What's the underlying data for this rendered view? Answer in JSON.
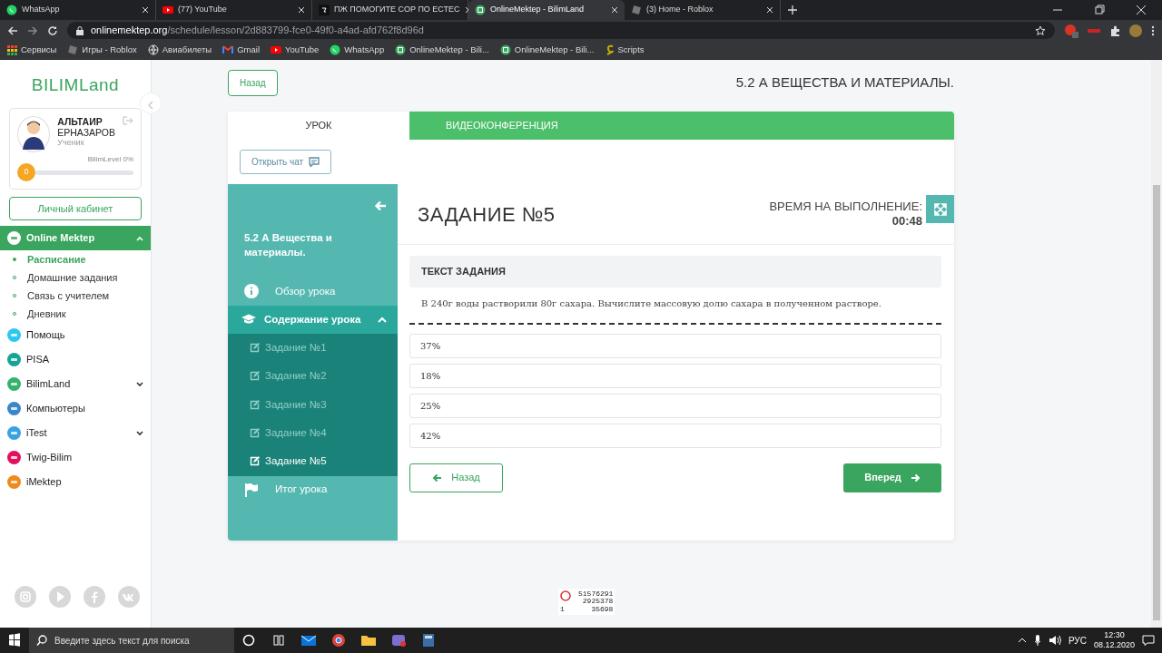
{
  "browser": {
    "tabs": [
      {
        "title": "WhatsApp",
        "kind": "whatsapp",
        "selected": false
      },
      {
        "title": "(77) YouTube",
        "kind": "youtube",
        "selected": false
      },
      {
        "title": "ПЖ ПОМОГИТЕ СОР ПО ЕСТЕС",
        "kind": "znanija",
        "selected": false
      },
      {
        "title": "OnlineMektep - BilimLand",
        "kind": "bilim",
        "selected": true
      },
      {
        "title": "(3) Home - Roblox",
        "kind": "roblox",
        "selected": false
      }
    ],
    "url_host": "onlinemektep.org",
    "url_path": "/schedule/lesson/2d883799-fce0-49f0-a4ad-afd762f8d96d",
    "bookmarks": [
      {
        "label": "Сервисы",
        "kind": "apps"
      },
      {
        "label": "Игры - Roblox",
        "kind": "roblox"
      },
      {
        "label": "Авиабилеты",
        "kind": "globe"
      },
      {
        "label": "Gmail",
        "kind": "gmail"
      },
      {
        "label": "YouTube",
        "kind": "youtube"
      },
      {
        "label": "WhatsApp",
        "kind": "whatsapp"
      },
      {
        "label": "OnlineMektep - Bili...",
        "kind": "bilim"
      },
      {
        "label": "OnlineMektep - Bili...",
        "kind": "bilim"
      },
      {
        "label": "Scripts",
        "kind": "script"
      }
    ]
  },
  "sidebar": {
    "logo": "BILIMLand",
    "user": {
      "first_name": "АЛЬТАИР",
      "last_name": "ЕРНАЗАРОВ",
      "role": "Ученик",
      "level_label": "BilimLevel 0%",
      "level_badge": "0",
      "level": 0
    },
    "cabinet_button": "Личный кабинет",
    "nav": [
      {
        "label": "Online Mektep",
        "color": "#ffffff",
        "expandable": true,
        "expanded": true,
        "children": [
          {
            "label": "Расписание",
            "selected": true
          },
          {
            "label": "Домашние задания",
            "selected": false
          },
          {
            "label": "Связь с учителем",
            "selected": false
          },
          {
            "label": "Дневник",
            "selected": false
          }
        ]
      },
      {
        "label": "Помощь",
        "color": "#2ec7f2",
        "expandable": false,
        "expanded": false
      },
      {
        "label": "PISA",
        "color": "#17a398",
        "expandable": false,
        "expanded": false
      },
      {
        "label": "BilimLand",
        "color": "#35b36a",
        "expandable": true,
        "expanded": false
      },
      {
        "label": "Компьютеры",
        "color": "#3a86c8",
        "expandable": false,
        "expanded": false
      },
      {
        "label": "iTest",
        "color": "#39a2e2",
        "expandable": true,
        "expanded": false
      },
      {
        "label": "Twig-Bilim",
        "color": "#e0125e",
        "expandable": false,
        "expanded": false
      },
      {
        "label": "iMektep",
        "color": "#ef8a1c",
        "expandable": false,
        "expanded": false
      }
    ],
    "socials": [
      {
        "kind": "instagram"
      },
      {
        "kind": "play"
      },
      {
        "kind": "facebook"
      },
      {
        "kind": "vk"
      }
    ]
  },
  "main": {
    "back_button": "Назад",
    "lesson_title": "5.2 А ВЕЩЕСТВА И МАТЕРИАЛЫ.",
    "tabs": [
      {
        "label": "УРОК",
        "selected": true
      },
      {
        "label": "ВИДЕОКОНФЕРЕНЦИЯ",
        "selected": false
      }
    ],
    "chat_button": "Открыть чат",
    "lesson_nav": {
      "title": "5.2 А Вещества и материалы.",
      "items": [
        {
          "label": "Обзор урока",
          "kind": "info"
        },
        {
          "label": "Содержание урока",
          "kind": "section",
          "expanded": true,
          "children": [
            {
              "label": "Задание №1",
              "selected": false
            },
            {
              "label": "Задание №2",
              "selected": false
            },
            {
              "label": "Задание №3",
              "selected": false
            },
            {
              "label": "Задание №4",
              "selected": false
            },
            {
              "label": "Задание №5",
              "selected": true
            }
          ]
        },
        {
          "label": "Итог урока",
          "kind": "flag"
        }
      ]
    },
    "task": {
      "title": "ЗАДАНИЕ №5",
      "timer_label": "ВРЕМЯ НА ВЫПОЛНЕНИЕ:",
      "timer": "00:48",
      "section_heading": "ТЕКСТ ЗАДАНИЯ",
      "question": "В 240г воды растворили 80г сахара. Вычислите массовую долю сахара в полученном растворе.",
      "options": [
        "37%",
        "18%",
        "25%",
        "42%"
      ],
      "prev_button": "Назад",
      "next_button": "Вперед"
    },
    "counter": {
      "lines": [
        "51576291",
        "2925378",
        "35698"
      ],
      "corner": "1"
    }
  },
  "taskbar": {
    "search_placeholder": "Введите здесь текст для поиска",
    "language": "РУС",
    "time": "12:30",
    "date": "08.12.2020"
  }
}
